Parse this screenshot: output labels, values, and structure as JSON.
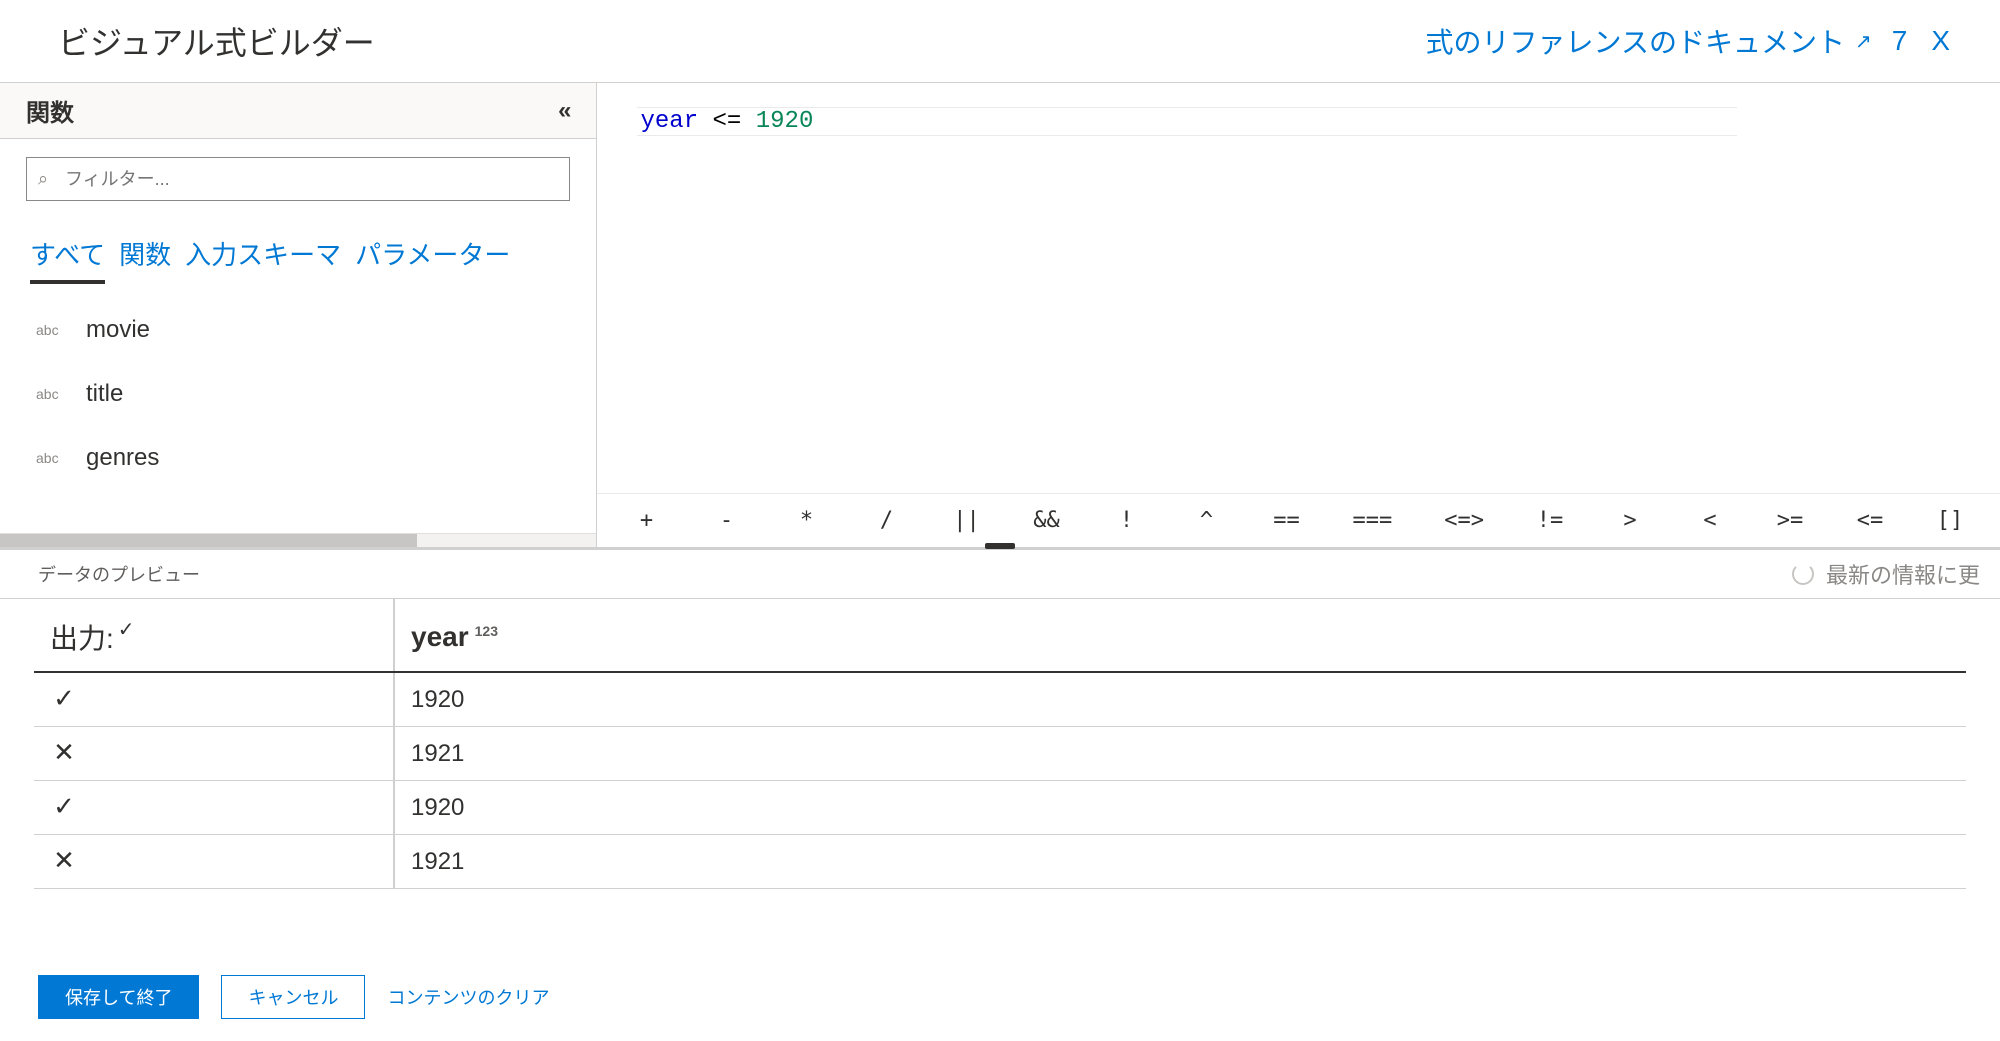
{
  "header": {
    "title": "ビジュアル式ビルダー",
    "docs_link": "式のリファレンスのドキュメント",
    "window_count": "7",
    "close_glyph": "X"
  },
  "sidebar": {
    "panel_title": "関数",
    "filter_placeholder": "フィルター...",
    "tabs": {
      "all": "すべて",
      "functions": "関数",
      "input_schema": "入力スキーマ",
      "parameters": "パラメーター"
    },
    "schema": [
      {
        "type": "abc",
        "name": "movie"
      },
      {
        "type": "abc",
        "name": "title"
      },
      {
        "type": "abc",
        "name": "genres"
      }
    ]
  },
  "editor": {
    "tokens": {
      "field": "year",
      "op": "<=",
      "num": "1920"
    },
    "operators": [
      "+",
      "-",
      "*",
      "/",
      "||",
      "&&",
      "!",
      "^",
      "==",
      "===",
      "<=>",
      "!=",
      ">",
      "<",
      ">=",
      "<=",
      "[]"
    ]
  },
  "preview": {
    "label": "データのプレビュー",
    "refresh_label": "最新の情報に更",
    "output_header": "出力:",
    "year_header": "year",
    "year_type": "123",
    "rows": [
      {
        "result": "check",
        "year": "1920"
      },
      {
        "result": "cross",
        "year": "1921"
      },
      {
        "result": "check",
        "year": "1920"
      },
      {
        "result": "cross",
        "year": "1921"
      }
    ]
  },
  "footer": {
    "save": "保存して終了",
    "cancel": "キャンセル",
    "clear": "コンテンツのクリア"
  }
}
